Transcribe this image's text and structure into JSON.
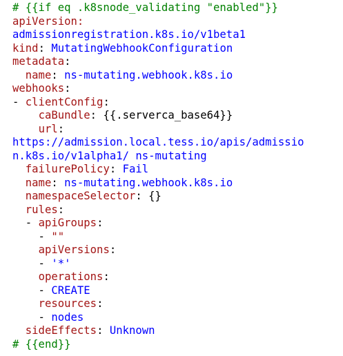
{
  "lines": [
    [
      {
        "t": "# {{if eq .k8snode_validating \"enabled\"}}",
        "c": "cmt"
      }
    ],
    [
      {
        "t": "apiVersion:",
        "c": "key"
      }
    ],
    [
      {
        "t": "admissionregistration.k8s.io/v1beta1",
        "c": "val"
      }
    ],
    [
      {
        "t": "kind",
        "c": "key"
      },
      {
        "t": ": ",
        "c": "plain"
      },
      {
        "t": "MutatingWebhookConfiguration",
        "c": "val"
      }
    ],
    [
      {
        "t": "metadata",
        "c": "key"
      },
      {
        "t": ":",
        "c": "plain"
      }
    ],
    [
      {
        "t": "  ",
        "c": "plain"
      },
      {
        "t": "name",
        "c": "key"
      },
      {
        "t": ": ",
        "c": "plain"
      },
      {
        "t": "ns-mutating.webhook.k8s.io",
        "c": "val"
      }
    ],
    [
      {
        "t": "webhooks",
        "c": "key"
      },
      {
        "t": ":",
        "c": "plain"
      }
    ],
    [
      {
        "t": "- ",
        "c": "plain"
      },
      {
        "t": "clientConfig",
        "c": "key"
      },
      {
        "t": ":",
        "c": "plain"
      }
    ],
    [
      {
        "t": "    ",
        "c": "plain"
      },
      {
        "t": "caBundle",
        "c": "key"
      },
      {
        "t": ": {{.serverca_base64}}",
        "c": "plain"
      }
    ],
    [
      {
        "t": "    ",
        "c": "plain"
      },
      {
        "t": "url",
        "c": "key"
      },
      {
        "t": ":",
        "c": "plain"
      }
    ],
    [
      {
        "t": "https://admission.local.tess.io/apis/admissio",
        "c": "val"
      }
    ],
    [
      {
        "t": "n.k8s.io/v1alpha1/ ns-mutating",
        "c": "val"
      }
    ],
    [
      {
        "t": "  ",
        "c": "plain"
      },
      {
        "t": "failurePolicy",
        "c": "key"
      },
      {
        "t": ": ",
        "c": "plain"
      },
      {
        "t": "Fail",
        "c": "val"
      }
    ],
    [
      {
        "t": "  ",
        "c": "plain"
      },
      {
        "t": "name",
        "c": "key"
      },
      {
        "t": ": ",
        "c": "plain"
      },
      {
        "t": "ns-mutating.webhook.k8s.io",
        "c": "val"
      }
    ],
    [
      {
        "t": "  ",
        "c": "plain"
      },
      {
        "t": "namespaceSelector",
        "c": "key"
      },
      {
        "t": ": {}",
        "c": "plain"
      }
    ],
    [
      {
        "t": "  ",
        "c": "plain"
      },
      {
        "t": "rules",
        "c": "key"
      },
      {
        "t": ":",
        "c": "plain"
      }
    ],
    [
      {
        "t": "  - ",
        "c": "plain"
      },
      {
        "t": "apiGroups",
        "c": "key"
      },
      {
        "t": ":",
        "c": "plain"
      }
    ],
    [
      {
        "t": "    - ",
        "c": "plain"
      },
      {
        "t": "\"\"",
        "c": "key"
      }
    ],
    [
      {
        "t": "    ",
        "c": "plain"
      },
      {
        "t": "apiVersions",
        "c": "key"
      },
      {
        "t": ":",
        "c": "plain"
      }
    ],
    [
      {
        "t": "    - ",
        "c": "plain"
      },
      {
        "t": "'*'",
        "c": "val"
      }
    ],
    [
      {
        "t": "    ",
        "c": "plain"
      },
      {
        "t": "operations",
        "c": "key"
      },
      {
        "t": ":",
        "c": "plain"
      }
    ],
    [
      {
        "t": "    - ",
        "c": "plain"
      },
      {
        "t": "CREATE",
        "c": "val"
      }
    ],
    [
      {
        "t": "    ",
        "c": "plain"
      },
      {
        "t": "resources",
        "c": "key"
      },
      {
        "t": ":",
        "c": "plain"
      }
    ],
    [
      {
        "t": "    - ",
        "c": "plain"
      },
      {
        "t": "nodes",
        "c": "val"
      }
    ],
    [
      {
        "t": "  ",
        "c": "plain"
      },
      {
        "t": "sideEffects",
        "c": "key"
      },
      {
        "t": ": ",
        "c": "plain"
      },
      {
        "t": "Unknown",
        "c": "val"
      }
    ],
    [
      {
        "t": "# {{end}}",
        "c": "cmt"
      }
    ]
  ],
  "colors": {
    "key": "#a31515",
    "value": "#0000ff",
    "comment": "#008000",
    "plain": "#000000",
    "background": "#ffffff"
  }
}
